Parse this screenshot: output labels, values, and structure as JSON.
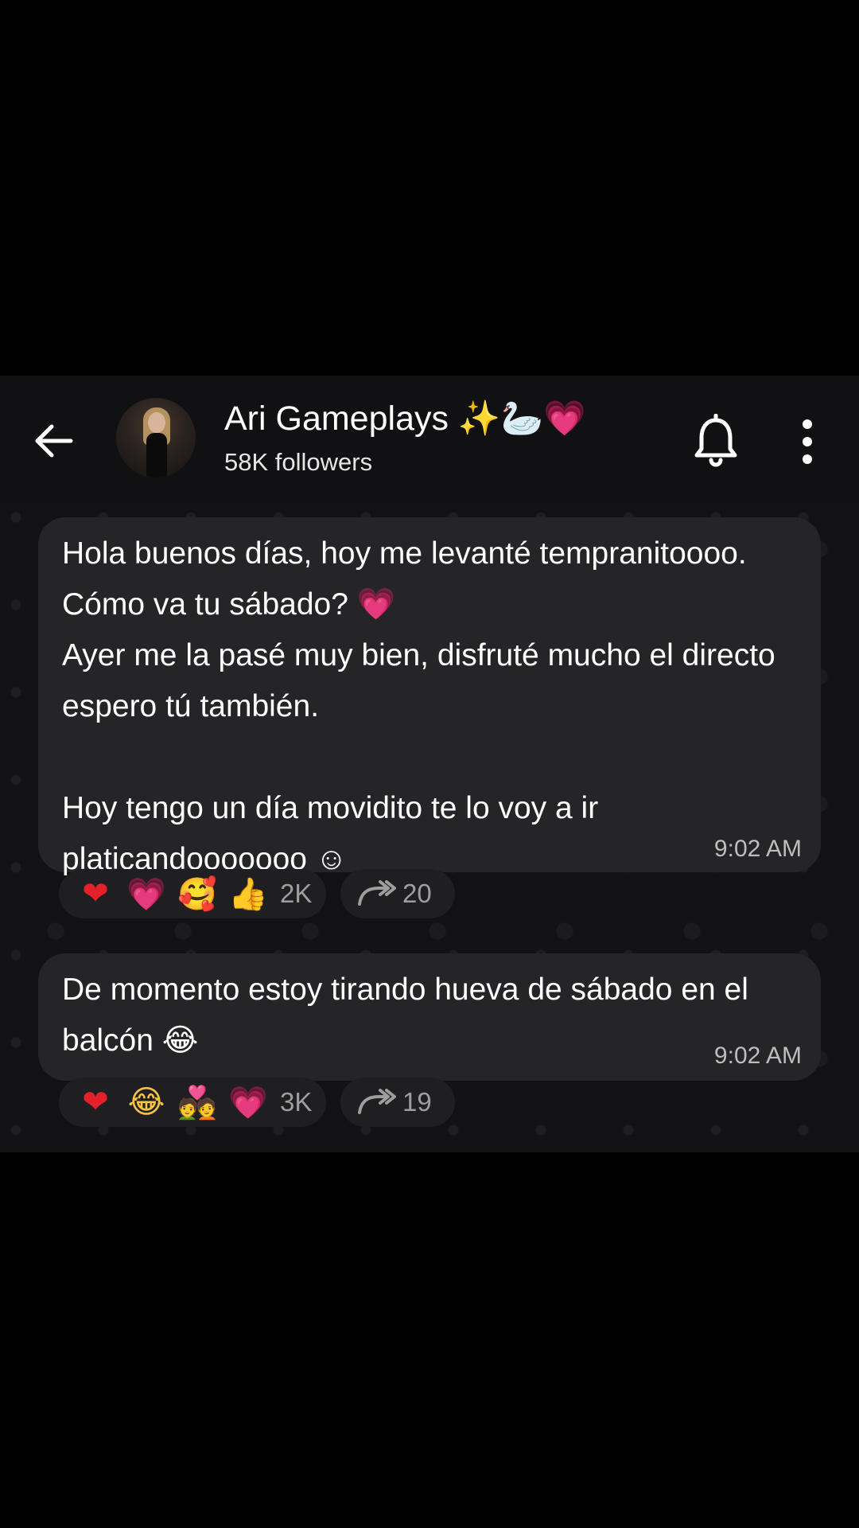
{
  "header": {
    "title": "Ari Gameplays ✨🦢💗",
    "subtitle": "58K followers"
  },
  "messages": [
    {
      "text": "Hola buenos días, hoy me levanté tempranitoooo. Cómo va tu sábado? 💗\nAyer me la pasé muy bien, disfruté mucho el directo espero tú también.\n\nHoy tengo un día movidito te lo voy a ir platicandooooooo ☺",
      "time": "9:02 AM",
      "reactions": [
        "❤",
        "💗",
        "🥰",
        "👍"
      ],
      "reaction_count": "2K",
      "forward_count": "20"
    },
    {
      "text": "De momento estoy tirando hueva de sábado en el balcón 😂",
      "time": "9:02 AM",
      "reactions": [
        "❤",
        "😂",
        "💑",
        "💗"
      ],
      "reaction_count": "3K",
      "forward_count": "19"
    }
  ],
  "colors": {
    "background": "#000000",
    "header": "#111113",
    "bubble": "#252527",
    "chip": "#1f1f22",
    "muted_text": "#9e9e9e"
  },
  "icons": {
    "back": "arrow-left-icon",
    "bell": "bell-icon",
    "menu": "more-vertical-icon",
    "forward": "forward-arrow-icon"
  }
}
